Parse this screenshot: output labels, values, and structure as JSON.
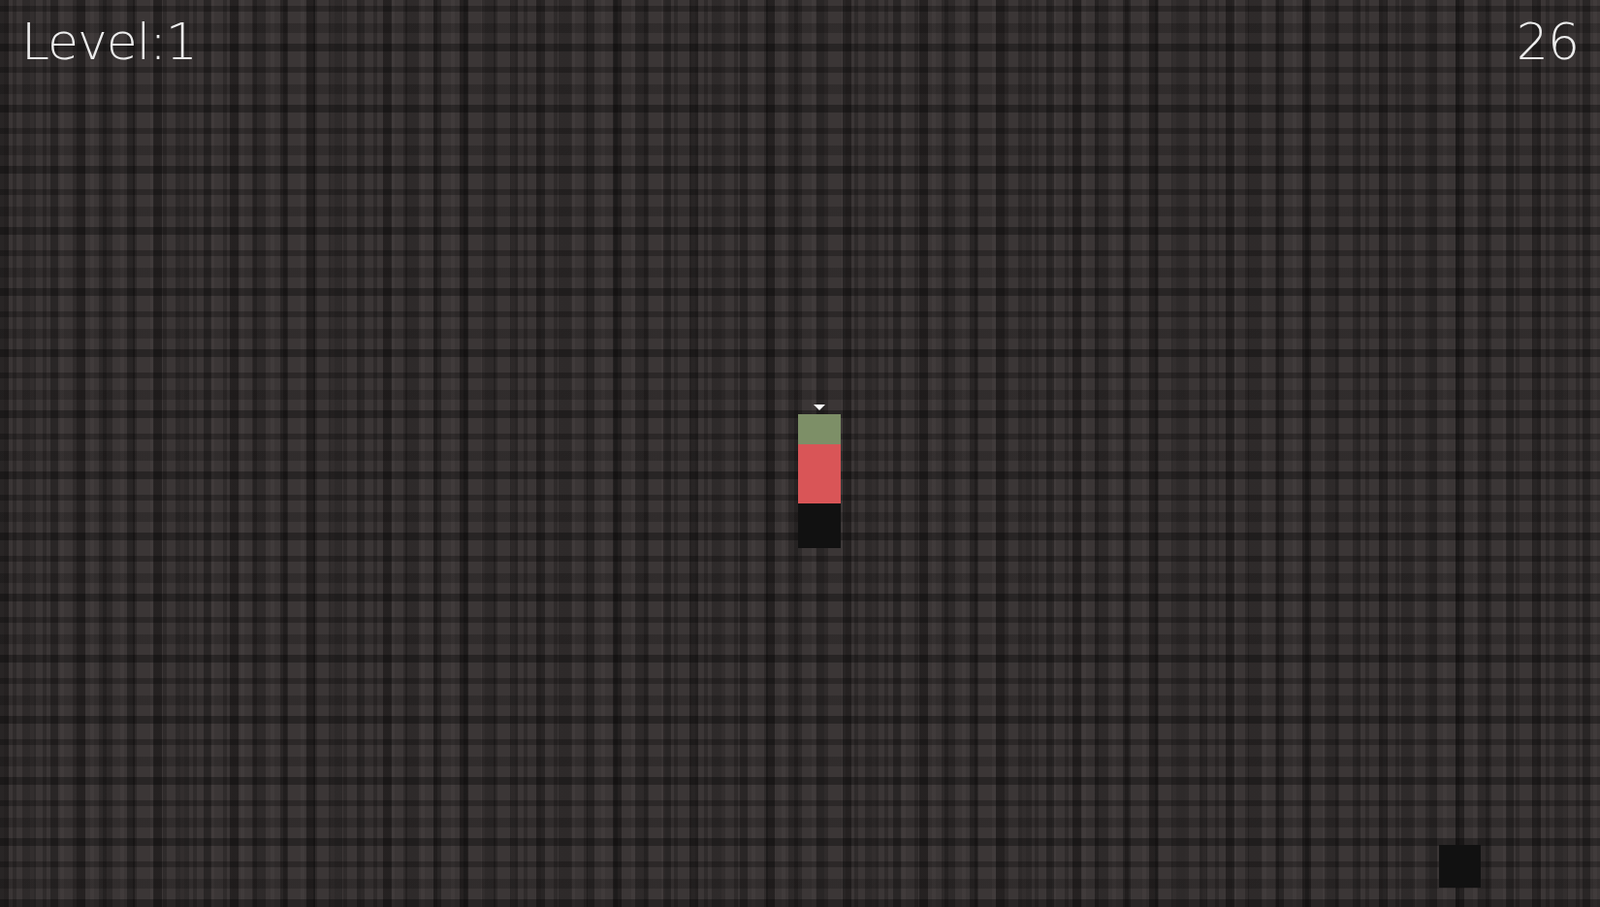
{
  "hud": {
    "level": "Level:1",
    "score": "26"
  },
  "column": {
    "segments": [
      {
        "kind": "head",
        "color": "#7d8f67"
      },
      {
        "kind": "body",
        "color": "#d95557"
      },
      {
        "kind": "tail",
        "color": "#111111"
      }
    ]
  }
}
